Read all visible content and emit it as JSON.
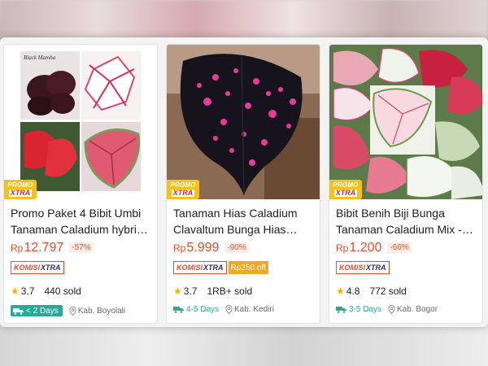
{
  "products": [
    {
      "title_line1": "Promo Paket 4 Bibit Umbi",
      "title_line2": "Tanaman Caladium hybrid…",
      "price_currency": "Rp",
      "price": "12.797",
      "discount": "-57%",
      "komisi_a": "KOMISI",
      "komisi_b": "XTRA",
      "rating": "3.7",
      "sold": "440 sold",
      "shipping": "< 2 Days",
      "location": "Kab. Boyolali",
      "image_caption": "Black Mamba"
    },
    {
      "title_line1": "Tanaman Hias Caladium",
      "title_line2": "Clavaltum Bunga Hias…",
      "price_currency": "Rp",
      "price": "5.999",
      "discount": "-90%",
      "komisi_a": "KOMISI",
      "komisi_b": "XTRA",
      "off_label": "Rp250 off",
      "rating": "3.7",
      "sold": "1RB+ sold",
      "shipping": "4-5 Days",
      "location": "Kab. Kediri"
    },
    {
      "title_line1": "Bibit Benih Biji Bunga",
      "title_line2": "Tanaman Caladium Mix -…",
      "price_currency": "Rp",
      "price": "1.200",
      "discount": "-66%",
      "komisi_a": "KOMISI",
      "komisi_b": "XTRA",
      "rating": "4.8",
      "sold": "772 sold",
      "shipping": "3-5 Days",
      "location": "Kab. Bogor"
    }
  ],
  "promo_badge": {
    "line1": "PROMO",
    "line2": "XTRA"
  },
  "colors": {
    "price": "#ee4d2d",
    "ship": "#26aa99",
    "promo": "#f7c117",
    "star": "#f5b400"
  },
  "icons": {
    "star": "star-icon",
    "truck": "truck-icon",
    "pin": "location-pin-icon"
  }
}
